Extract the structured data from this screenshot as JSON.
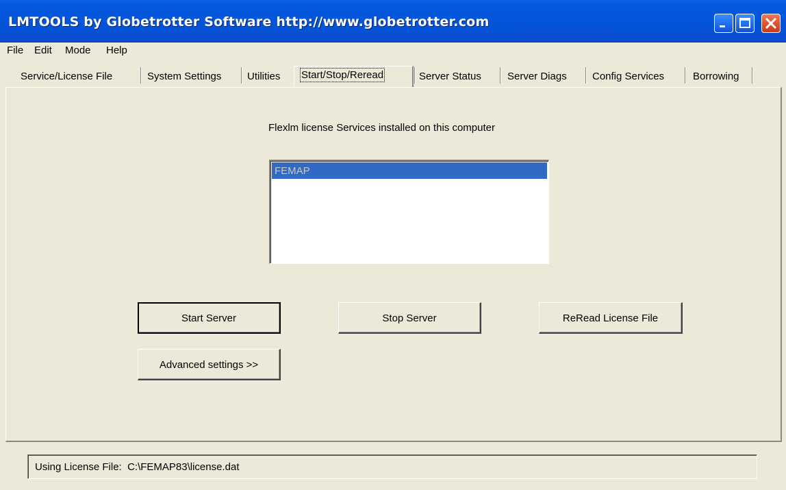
{
  "window": {
    "title": "LMTOOLS by Globetrotter Software http://www.globetrotter.com"
  },
  "menu": {
    "items": [
      {
        "label": "File"
      },
      {
        "label": "Edit"
      },
      {
        "label": "Mode"
      },
      {
        "label": "Help"
      }
    ]
  },
  "tabs": [
    {
      "label": "Service/License File"
    },
    {
      "label": "System Settings"
    },
    {
      "label": "Utilities"
    },
    {
      "label": "Start/Stop/Reread",
      "active": true
    },
    {
      "label": "Server Status"
    },
    {
      "label": "Server Diags"
    },
    {
      "label": "Config Services"
    },
    {
      "label": "Borrowing"
    }
  ],
  "main": {
    "heading": "Flexlm license Services installed on this computer",
    "services": [
      {
        "name": "FEMAP",
        "selected": true
      }
    ],
    "buttons": {
      "start": "Start Server",
      "stop": "Stop Server",
      "reread": "ReRead License File",
      "advanced": "Advanced settings >>"
    }
  },
  "status": {
    "prefix": "Using License File:",
    "path": "C:\\FEMAP83\\license.dat"
  },
  "colors": {
    "titlebar": "#0454d8",
    "selection": "#316ac5",
    "face": "#ece9d8",
    "close": "#e0502c"
  },
  "icons": {
    "minimize": "minimize-icon",
    "maximize": "maximize-icon",
    "close": "close-icon"
  }
}
